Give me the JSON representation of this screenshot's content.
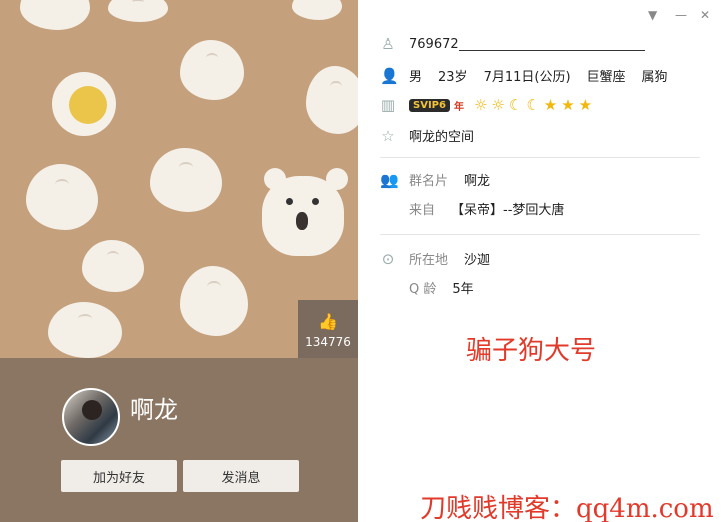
{
  "profile": {
    "nickname": "啊龙",
    "likes": "134776",
    "add_friend_label": "加为好友",
    "send_message_label": "发消息"
  },
  "info": {
    "qq_number": "769672",
    "gender": "男",
    "age": "23岁",
    "birthday": "7月11日(公历)",
    "zodiac": "巨蟹座",
    "chinese_zodiac": "属狗",
    "svip_badge": "SVIP6",
    "svip_year": "年",
    "level_icons": [
      "☼",
      "☼",
      "☾",
      "☾",
      "★",
      "★",
      "★"
    ],
    "space": "啊龙的空间",
    "group_card_label": "群名片",
    "group_card_value": "啊龙",
    "from_label": "来自",
    "from_value": "【呆帝】--梦回大唐",
    "location_label": "所在地",
    "location_value": "沙迦",
    "q_age_label": "Q 龄",
    "q_age_value": "5年"
  },
  "overlay": {
    "fake_note": "骗子狗大号",
    "watermark": "刀贱贱博客：qq4m.com"
  }
}
